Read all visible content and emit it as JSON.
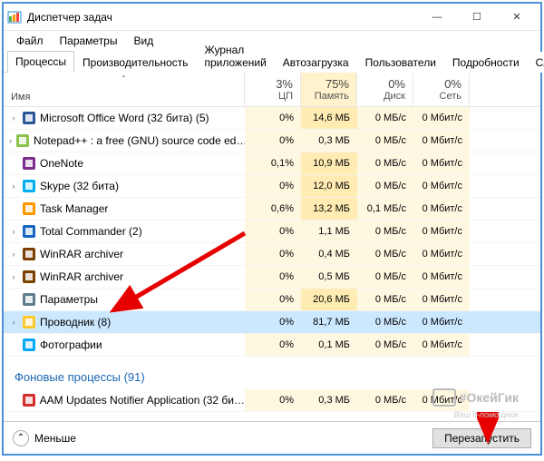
{
  "window": {
    "title": "Диспетчер задач"
  },
  "win_controls": {
    "min": "—",
    "max": "☐",
    "close": "✕"
  },
  "menu": {
    "file": "Файл",
    "options": "Параметры",
    "view": "Вид"
  },
  "tabs": {
    "items": [
      "Процессы",
      "Производительность",
      "Журнал приложений",
      "Автозагрузка",
      "Пользователи",
      "Подробности",
      "Службы"
    ],
    "active": 0
  },
  "columns": {
    "name": "Имя",
    "cpu": {
      "pct": "3%",
      "label": "ЦП"
    },
    "mem": {
      "pct": "75%",
      "label": "Память"
    },
    "disk": {
      "pct": "0%",
      "label": "Диск"
    },
    "net": {
      "pct": "0%",
      "label": "Сеть"
    }
  },
  "rows": [
    {
      "exp": true,
      "icon": "word",
      "name": "Microsoft Office Word (32 бита) (5)",
      "cpu": "0%",
      "mem": "14,6 МБ",
      "disk": "0 МБ/с",
      "net": "0 Мбит/с",
      "memHeat": 2
    },
    {
      "exp": true,
      "icon": "npp",
      "name": "Notepad++ : a free (GNU) source code ed…",
      "cpu": "0%",
      "mem": "0,3 МБ",
      "disk": "0 МБ/с",
      "net": "0 Мбит/с",
      "memHeat": 1
    },
    {
      "exp": false,
      "icon": "onenote",
      "name": "OneNote",
      "cpu": "0,1%",
      "mem": "10,9 МБ",
      "disk": "0 МБ/с",
      "net": "0 Мбит/с",
      "memHeat": 2
    },
    {
      "exp": true,
      "icon": "skype",
      "name": "Skype (32 бита)",
      "cpu": "0%",
      "mem": "12,0 МБ",
      "disk": "0 МБ/с",
      "net": "0 Мбит/с",
      "memHeat": 2
    },
    {
      "exp": false,
      "icon": "taskmgr",
      "name": "Task Manager",
      "cpu": "0,6%",
      "mem": "13,2 МБ",
      "disk": "0,1 МБ/с",
      "net": "0 Мбит/с",
      "memHeat": 2
    },
    {
      "exp": true,
      "icon": "totcmd",
      "name": "Total Commander (2)",
      "cpu": "0%",
      "mem": "1,1 МБ",
      "disk": "0 МБ/с",
      "net": "0 Мбит/с",
      "memHeat": 1
    },
    {
      "exp": true,
      "icon": "winrar",
      "name": "WinRAR archiver",
      "cpu": "0%",
      "mem": "0,4 МБ",
      "disk": "0 МБ/с",
      "net": "0 Мбит/с",
      "memHeat": 1
    },
    {
      "exp": true,
      "icon": "winrar",
      "name": "WinRAR archiver",
      "cpu": "0%",
      "mem": "0,5 МБ",
      "disk": "0 МБ/с",
      "net": "0 Мбит/с",
      "memHeat": 1
    },
    {
      "exp": false,
      "icon": "settings",
      "name": "Параметры",
      "cpu": "0%",
      "mem": "20,6 МБ",
      "disk": "0 МБ/с",
      "net": "0 Мбит/с",
      "memHeat": 2
    },
    {
      "exp": true,
      "icon": "explorer",
      "name": "Проводник (8)",
      "cpu": "0%",
      "mem": "81,7 МБ",
      "disk": "0 МБ/с",
      "net": "0 Мбит/с",
      "memHeat": 3,
      "selected": true
    },
    {
      "exp": false,
      "icon": "photos",
      "name": "Фотографии",
      "cpu": "0%",
      "mem": "0,1 МБ",
      "disk": "0 МБ/с",
      "net": "0 Мбит/с",
      "memHeat": 1
    }
  ],
  "bg_section": {
    "title": "Фоновые процессы (91)"
  },
  "bg_rows": [
    {
      "exp": false,
      "icon": "adobe",
      "name": "AAM Updates Notifier Application (32 би…",
      "cpu": "0%",
      "mem": "0,3 МБ",
      "disk": "0 МБ/с",
      "net": "0 Мбит/с",
      "memHeat": 1
    }
  ],
  "footer": {
    "less": "Меньше",
    "restart": "Перезапустить"
  },
  "watermark": {
    "main": "#ОкейГик",
    "sub": "Ваш it-помощник"
  },
  "icon_colors": {
    "word": "#2b579a",
    "npp": "#8bc34a",
    "onenote": "#7b2d8e",
    "skype": "#00aff0",
    "taskmgr": "#ff9800",
    "totcmd": "#1565c0",
    "winrar": "#7b3f00",
    "settings": "#607d8b",
    "explorer": "#ffca28",
    "photos": "#03a9f4",
    "adobe": "#d32f2f"
  }
}
